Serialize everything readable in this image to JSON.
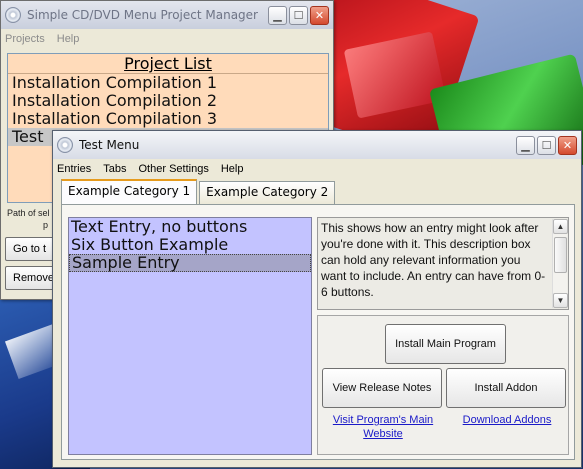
{
  "project_manager": {
    "title": "Simple CD/DVD Menu Project Manager",
    "menu": [
      "Projects",
      "Help"
    ],
    "list_header": "Project List",
    "projects": [
      "Installation Compilation 1",
      "Installation Compilation 2",
      "Installation Compilation 3",
      "Test"
    ],
    "selected_index": 3,
    "path_label": [
      "Path of sel",
      "p"
    ],
    "goto_button": "Go to t",
    "remove_button": "Remove"
  },
  "test_menu": {
    "title": "Test Menu",
    "menu": [
      "Entries",
      "Tabs",
      "Other Settings",
      "Help"
    ],
    "tabs": [
      "Example Category 1",
      "Example Category 2"
    ],
    "active_tab": 0,
    "entries": [
      "Text Entry, no buttons",
      "Six Button Example",
      "Sample Entry"
    ],
    "selected_entry": 2,
    "description": "This shows how an entry might look after you're done with it. This description box can hold any relevant information you want to include. An entry can have from 0-6 buttons.",
    "buttons": {
      "install_main": "Install Main Program",
      "view_notes": "View Release Notes",
      "install_addon": "Install Addon"
    },
    "links": {
      "visit_site": "Visit Program's Main Website",
      "download_addons": "Download Addons"
    }
  },
  "colors": {
    "project_list_bg": "#ffdbba",
    "entries_bg": "#c3c3ff",
    "link": "#1a1ac8",
    "close_button": "#d4492e"
  }
}
